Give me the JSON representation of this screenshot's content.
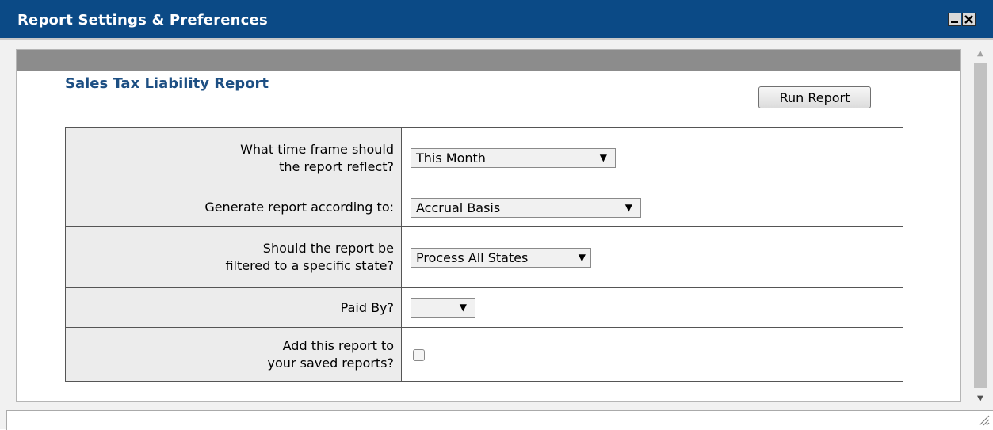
{
  "window": {
    "title": "Report Settings & Preferences",
    "minimize_icon": "minimize-icon",
    "close_icon": "close-icon"
  },
  "report": {
    "title": "Sales Tax Liability Report",
    "run_button": "Run Report"
  },
  "settings": {
    "time_frame": {
      "label_line1": "What time frame should",
      "label_line2": "the report reflect?",
      "selected": "This Month"
    },
    "basis": {
      "label": "Generate report according to:",
      "selected": "Accrual Basis"
    },
    "state_filter": {
      "label_line1": "Should the report be",
      "label_line2": "filtered to a specific state?",
      "selected": "Process All States"
    },
    "paid_by": {
      "label": "Paid By?",
      "selected": ""
    },
    "save_report": {
      "label_line1": "Add this report to",
      "label_line2": "your saved reports?",
      "checked": false
    }
  },
  "colors": {
    "titlebar": "#0b4a86",
    "report_title": "#1d4f83",
    "header_bar": "#8c8c8c",
    "label_cell": "#ececec"
  },
  "icons": {
    "dropdown": "dropdown-arrow-icon",
    "scroll_up": "scroll-up-icon",
    "scroll_down": "scroll-down-icon",
    "resize": "resize-grip-icon"
  }
}
